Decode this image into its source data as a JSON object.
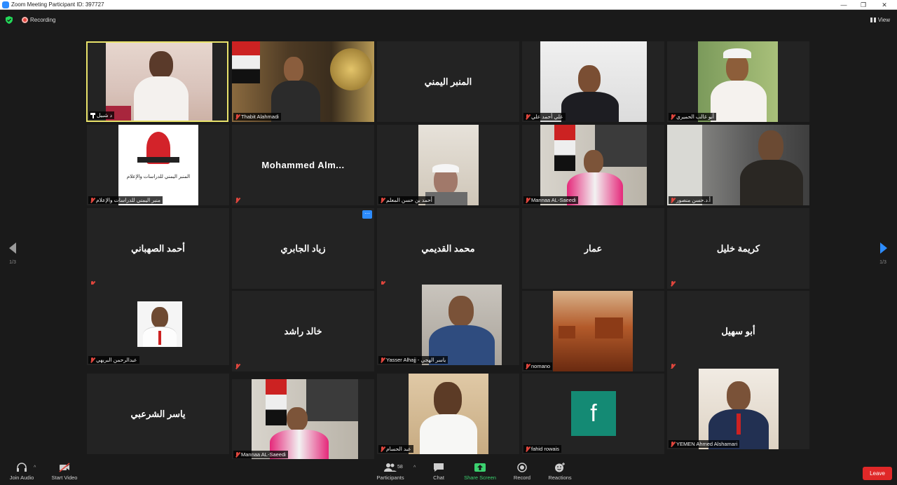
{
  "window": {
    "title": "Zoom Meeting Participant ID: 397727",
    "controls": [
      "—",
      "❐",
      "✕"
    ]
  },
  "topbar": {
    "recording_label": "Recording",
    "view_label": "View"
  },
  "pagination": {
    "left": "1/3",
    "right": "1/3"
  },
  "tiles": [
    {
      "label": "د شبيل",
      "type": "video",
      "active": true,
      "pinned": true
    },
    {
      "label": "Thabit Alahmadi",
      "type": "video"
    },
    {
      "label": "",
      "card": "المنبر اليمني",
      "type": "name"
    },
    {
      "label": "علي أحمد علي",
      "type": "video"
    },
    {
      "label": "أبو غالب الحميري",
      "type": "video"
    },
    {
      "label": "منبر اليمني للدراسات والإعلام",
      "type": "logo",
      "logo_text": "المنبر اليمني للدراسات والإعلام"
    },
    {
      "label": "",
      "card": "Mohammed  Alm...",
      "type": "name-latin"
    },
    {
      "label": "أحمد بن حسن المعلم",
      "type": "video"
    },
    {
      "label": "Mannaa AL-Saeedi",
      "type": "video"
    },
    {
      "label": "أ.د.حسن منصور",
      "type": "video"
    },
    {
      "label": "",
      "card": "أحمد الصهباني",
      "type": "name"
    },
    {
      "label": "",
      "card": "زياد الجابري",
      "type": "name",
      "more": "···"
    },
    {
      "label": "",
      "card": "محمد القديمي",
      "type": "name"
    },
    {
      "label": "",
      "card": "عمار",
      "type": "name"
    },
    {
      "label": "",
      "card": "كريمة خليل",
      "type": "name"
    },
    {
      "label": "عبدالرحمن البريهي",
      "type": "video"
    },
    {
      "label": "",
      "card": "خالد راشد",
      "type": "name"
    },
    {
      "label": "Yasser Alhajj - ياسر الهجي",
      "type": "video"
    },
    {
      "label": "nomano",
      "type": "video"
    },
    {
      "label": "",
      "card": "أبو سهيل",
      "type": "name"
    },
    {
      "label": "",
      "card": "ياسر الشرعبي",
      "type": "name"
    },
    {
      "label": "Mannaa AL-Saeedi",
      "type": "video"
    },
    {
      "label": "عبد الحسام",
      "type": "video"
    },
    {
      "label": "fahid rowais",
      "type": "avatar",
      "avatar_letter": "f"
    },
    {
      "label": "YEMEN Ahmed Alshamari",
      "type": "video"
    }
  ],
  "toolbar": {
    "join_audio": "Join Audio",
    "start_video": "Start Video",
    "participants": "Participants",
    "participants_count": "58",
    "chat": "Chat",
    "share_screen": "Share Screen",
    "record": "Record",
    "reactions": "Reactions",
    "leave": "Leave"
  },
  "colors": {
    "active_speaker": "#e8e26a",
    "leave": "#e02828",
    "share": "#3bd16f",
    "accent": "#2d8cff"
  }
}
